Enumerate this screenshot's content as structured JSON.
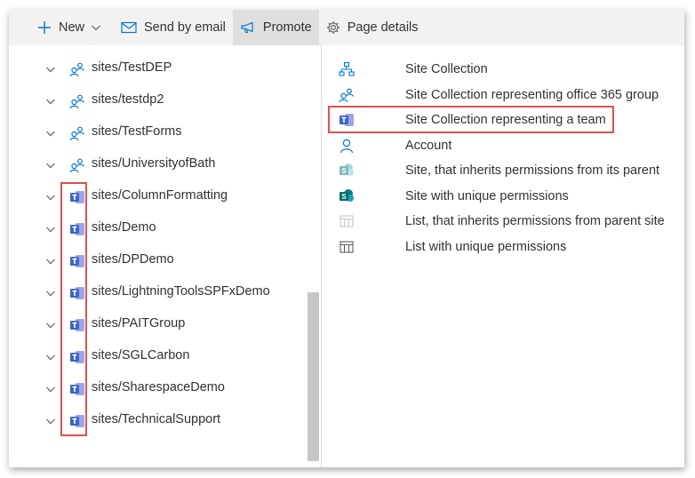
{
  "toolbar": {
    "new_label": "New",
    "send_email_label": "Send by email",
    "promote_label": "Promote",
    "page_details_label": "Page details"
  },
  "tree": {
    "items": [
      {
        "label": "sites/TestDEP",
        "icon": "group-site-icon"
      },
      {
        "label": "sites/testdp2",
        "icon": "group-site-icon"
      },
      {
        "label": "sites/TestForms",
        "icon": "group-site-icon"
      },
      {
        "label": "sites/UniversityofBath",
        "icon": "group-site-icon"
      },
      {
        "label": "sites/ColumnFormatting",
        "icon": "teams-icon"
      },
      {
        "label": "sites/Demo",
        "icon": "teams-icon"
      },
      {
        "label": "sites/DPDemo",
        "icon": "teams-icon"
      },
      {
        "label": "sites/LightningToolsSPFxDemo",
        "icon": "teams-icon"
      },
      {
        "label": "sites/PAITGroup",
        "icon": "teams-icon"
      },
      {
        "label": "sites/SGLCarbon",
        "icon": "teams-icon"
      },
      {
        "label": "sites/SharespaceDemo",
        "icon": "teams-icon"
      },
      {
        "label": "sites/TechnicalSupport",
        "icon": "teams-icon"
      }
    ]
  },
  "legend": {
    "items": [
      {
        "label": "Site Collection",
        "icon": "hierarchy-icon"
      },
      {
        "label": "Site Collection representing office 365 group",
        "icon": "group-site-icon"
      },
      {
        "label": "Site Collection representing a team",
        "icon": "teams-icon"
      },
      {
        "label": "Account",
        "icon": "person-icon"
      },
      {
        "label": "Site, that inherits permissions from its parent",
        "icon": "sharepoint-faded-icon"
      },
      {
        "label": "Site with unique permissions",
        "icon": "sharepoint-icon"
      },
      {
        "label": "List, that inherits permissions from parent site",
        "icon": "list-faded-icon"
      },
      {
        "label": "List with unique permissions",
        "icon": "list-icon"
      }
    ]
  },
  "colors": {
    "accent": "#0078d4",
    "teams": "#3e64c4",
    "highlight": "#d9534f",
    "toolbar_bg": "#f3f2f1"
  }
}
